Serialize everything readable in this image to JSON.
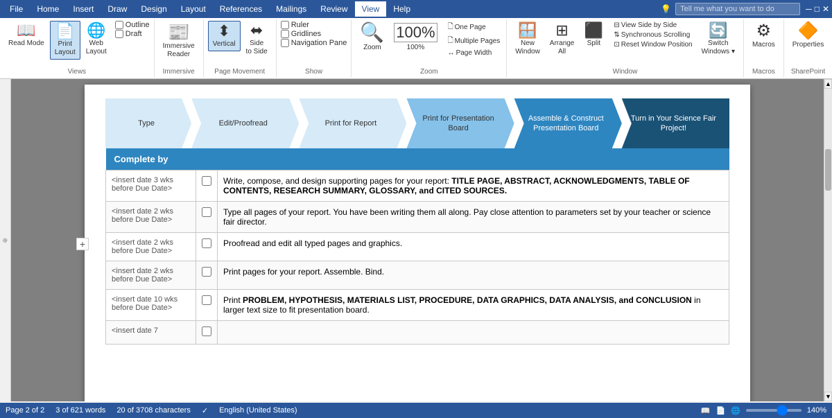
{
  "ribbon": {
    "tabs": [
      "File",
      "Home",
      "Insert",
      "Draw",
      "Design",
      "Layout",
      "References",
      "Mailings",
      "Review",
      "View",
      "Help"
    ],
    "active_tab": "View",
    "search_placeholder": "Tell me what you want to do",
    "groups": {
      "views": {
        "label": "Views",
        "buttons": [
          {
            "id": "read-mode",
            "label": "Read\nMode",
            "icon": "📖"
          },
          {
            "id": "print-layout",
            "label": "Print\nLayout",
            "icon": "📄"
          },
          {
            "id": "web-layout",
            "label": "Web\nLayout",
            "icon": "🌐"
          }
        ],
        "checks": [
          "Outline",
          "Draft"
        ]
      },
      "immersive": {
        "label": "Immersive",
        "buttons": [
          {
            "id": "immersive-reader",
            "label": "Immersive\nReader",
            "icon": "📰"
          }
        ]
      },
      "page_movement": {
        "label": "Page Movement",
        "buttons": [
          {
            "id": "vertical",
            "label": "Vertical",
            "icon": "⬆",
            "active": true
          },
          {
            "id": "side-to-side",
            "label": "Side\nto Side",
            "icon": "↔"
          }
        ]
      },
      "show": {
        "label": "Show",
        "checks": [
          "Ruler",
          "Gridlines",
          "Navigation Pane"
        ]
      },
      "zoom": {
        "label": "Zoom",
        "buttons": [
          {
            "id": "zoom-btn",
            "label": "Zoom",
            "icon": "🔍"
          },
          {
            "id": "zoom-pct-btn",
            "label": "100%",
            "icon": ""
          },
          {
            "id": "one-page",
            "label": "One Page",
            "icon": ""
          },
          {
            "id": "multiple-pages",
            "label": "Multiple Pages",
            "icon": ""
          },
          {
            "id": "page-width",
            "label": "Page Width",
            "icon": ""
          }
        ]
      },
      "window": {
        "label": "Window",
        "buttons": [
          {
            "id": "new-window",
            "label": "New\nWindow",
            "icon": ""
          },
          {
            "id": "arrange-all",
            "label": "Arrange\nAll",
            "icon": ""
          },
          {
            "id": "split",
            "label": "Split",
            "icon": ""
          }
        ],
        "mini": [
          "View Side by Side",
          "Synchronous Scrolling",
          "Reset Window Position"
        ],
        "switch_label": "Switch\nWindows"
      },
      "macros": {
        "label": "Macros",
        "button": "Macros"
      },
      "sharepoint": {
        "label": "SharePoint",
        "button": "Properties"
      }
    }
  },
  "process_steps": [
    {
      "label": "Type",
      "style": "light-first"
    },
    {
      "label": "Edit/Proofread",
      "style": "light"
    },
    {
      "label": "Print for Report",
      "style": "light"
    },
    {
      "label": "Print for Presentation Board",
      "style": "medium"
    },
    {
      "label": "Assemble & Construct Presentation Board",
      "style": "dark"
    },
    {
      "label": "Turn in Your Science Fair Project!",
      "style": "darkest"
    }
  ],
  "table": {
    "header": "Complete by",
    "rows": [
      {
        "date": "<insert date 3 wks before Due Date>",
        "checked": false,
        "content": "Write, compose, and design supporting pages for your report: <b>TITLE PAGE, ABSTRACT, ACKNOWLEDGMENTS, TABLE OF CONTENTS, RESEARCH SUMMARY, GLOSSARY, and CITED SOURCES.</b>"
      },
      {
        "date": "<insert date 2 wks before Due Date>",
        "checked": false,
        "content": "Type all pages of your report. You have been writing them all along. Pay close attention to parameters set by your teacher or science fair director."
      },
      {
        "date": "<insert date 2 wks before Due Date>",
        "checked": false,
        "content": "Proofread and edit all typed pages and graphics."
      },
      {
        "date": "<insert date 2 wks before Due Date>",
        "checked": false,
        "content": "Print pages for your report. Assemble. Bind."
      },
      {
        "date": "<insert date 10 wks before Due Date>",
        "checked": false,
        "content": "Print <b>PROBLEM, HYPOTHESIS, MATERIALS LIST, PROCEDURE, DATA GRAPHICS, DATA ANALYSIS, and CONCLUSION</b> in larger text size to fit presentation board."
      },
      {
        "date": "<insert date 7",
        "checked": false,
        "content": ""
      }
    ]
  },
  "status": {
    "page": "Page 2 of 2",
    "words": "3 of 621 words",
    "chars": "20 of 3708 characters",
    "language": "English (United States)",
    "zoom": "140%"
  }
}
